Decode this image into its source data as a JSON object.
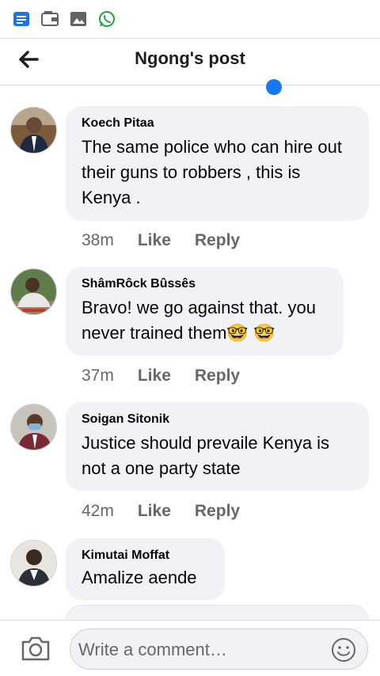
{
  "header": {
    "title": "Ngong's post"
  },
  "status_icons": [
    "message-app-icon",
    "wallet-icon",
    "gallery-icon",
    "whatsapp-icon"
  ],
  "comments": [
    {
      "author": "Koech Pitaa",
      "text": "The same police who can hire out their guns to robbers , this is Kenya .",
      "time": "38m",
      "like": "Like",
      "reply": "Reply"
    },
    {
      "author": "ShâmRôck Bûssês",
      "text": "Bravo! we go against that. you never trained them🤓 🤓",
      "time": "37m",
      "like": "Like",
      "reply": "Reply"
    },
    {
      "author": "Soigan Sitonik",
      "text": "Justice should prevaile Kenya is not a one party state",
      "time": "42m",
      "like": "Like",
      "reply": "Reply"
    },
    {
      "author": "Kimutai Moffat",
      "text": "Amalize aende"
    }
  ],
  "composer": {
    "placeholder": "Write a comment…"
  },
  "colors": {
    "accent": "#1877f2",
    "bubble": "#f0f2f5",
    "meta": "#65676b"
  }
}
